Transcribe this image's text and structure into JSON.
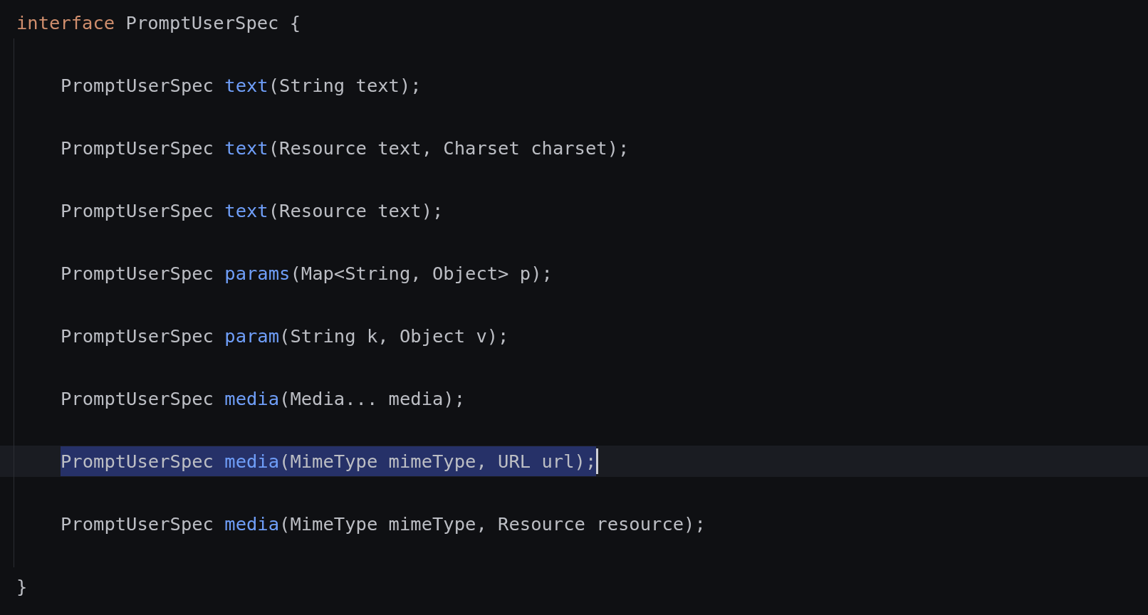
{
  "declaration": {
    "tokens": [
      {
        "kind": "keyword",
        "text": "interface"
      },
      {
        "kind": "plain",
        "text": " PromptUserSpec {"
      }
    ],
    "members": [
      {
        "selected": false,
        "tokens": [
          {
            "kind": "plain",
            "text": "PromptUserSpec "
          },
          {
            "kind": "method",
            "text": "text"
          },
          {
            "kind": "plain",
            "text": "(String text);"
          }
        ]
      },
      {
        "selected": false,
        "tokens": [
          {
            "kind": "plain",
            "text": "PromptUserSpec "
          },
          {
            "kind": "method",
            "text": "text"
          },
          {
            "kind": "plain",
            "text": "(Resource text, Charset charset);"
          }
        ]
      },
      {
        "selected": false,
        "tokens": [
          {
            "kind": "plain",
            "text": "PromptUserSpec "
          },
          {
            "kind": "method",
            "text": "text"
          },
          {
            "kind": "plain",
            "text": "(Resource text);"
          }
        ]
      },
      {
        "selected": false,
        "tokens": [
          {
            "kind": "plain",
            "text": "PromptUserSpec "
          },
          {
            "kind": "method",
            "text": "params"
          },
          {
            "kind": "plain",
            "text": "(Map<String, Object> p);"
          }
        ]
      },
      {
        "selected": false,
        "tokens": [
          {
            "kind": "plain",
            "text": "PromptUserSpec "
          },
          {
            "kind": "method",
            "text": "param"
          },
          {
            "kind": "plain",
            "text": "(String k, Object v);"
          }
        ]
      },
      {
        "selected": false,
        "tokens": [
          {
            "kind": "plain",
            "text": "PromptUserSpec "
          },
          {
            "kind": "method",
            "text": "media"
          },
          {
            "kind": "plain",
            "text": "(Media... media);"
          }
        ]
      },
      {
        "selected": true,
        "tokens": [
          {
            "kind": "plain",
            "text": "PromptUserSpec "
          },
          {
            "kind": "method",
            "text": "media"
          },
          {
            "kind": "plain",
            "text": "(MimeType mimeType, URL url);"
          }
        ]
      },
      {
        "selected": false,
        "tokens": [
          {
            "kind": "plain",
            "text": "PromptUserSpec "
          },
          {
            "kind": "method",
            "text": "media"
          },
          {
            "kind": "plain",
            "text": "(MimeType mimeType, Resource resource);"
          }
        ]
      }
    ],
    "closing": "}"
  }
}
